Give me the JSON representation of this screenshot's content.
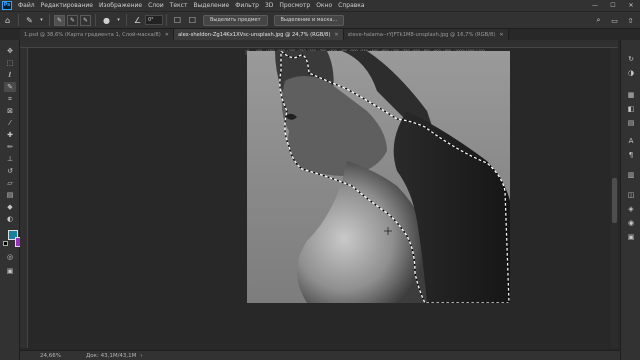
{
  "app": {
    "logo": "Ps",
    "colors": {
      "accent": "#31a8ff",
      "foreground_swatch": "#16819a",
      "background_swatch": "#9b2fc4"
    }
  },
  "menu": [
    "Файл",
    "Редактирование",
    "Изображение",
    "Слои",
    "Текст",
    "Выделение",
    "Фильтр",
    "3D",
    "Просмотр",
    "Окно",
    "Справка"
  ],
  "window_controls": {
    "minimize": "—",
    "maximize": "☐",
    "close": "✕"
  },
  "options": {
    "feather_value": "0°",
    "select_subject_label": "Выделить предмет",
    "select_and_mask_label": "Выделение и маска..."
  },
  "tabs": [
    {
      "label": "1.psd @ 38,6% (Карта градиента 1, Слой-маска/8)",
      "active": false
    },
    {
      "label": "alex-sheldon-Zg14Kx1XVsc-unsplash.jpg @ 24,7% (RGB/8)",
      "active": true
    },
    {
      "label": "steve-halama--rYJFTk1M8-unsplash.jpg @ 16,7% (RGB/8)",
      "active": false
    }
  ],
  "ruler_ticks": [
    "0",
    "50",
    "100",
    "150",
    "200",
    "250",
    "300",
    "350",
    "400",
    "450",
    "500",
    "550",
    "600",
    "650",
    "700",
    "750",
    "800",
    "850",
    "900",
    "950",
    "1000",
    "1050",
    "1100"
  ],
  "status": {
    "zoom": "24,66%",
    "doc": "Док: 43,1M/43,1M"
  }
}
